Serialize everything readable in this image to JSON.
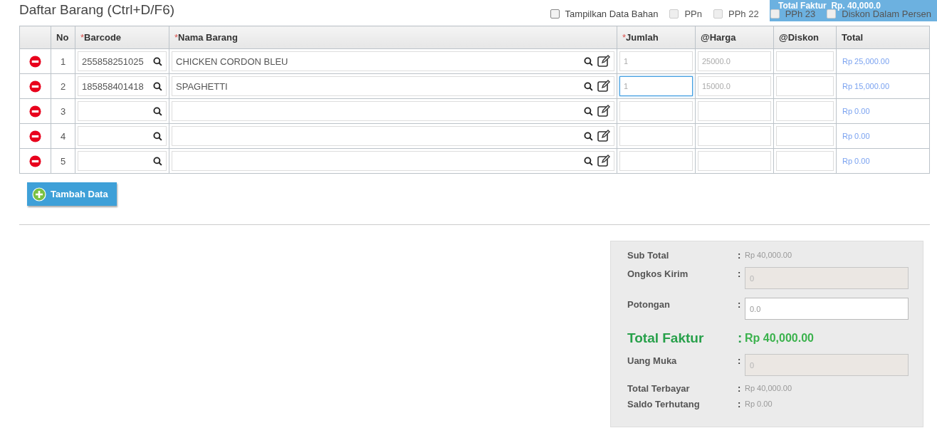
{
  "title": "Daftar Barang (Ctrl+D/F6)",
  "banner": {
    "label": "Total Faktur",
    "value": "Rp. 40,000.0"
  },
  "options": [
    {
      "label": "Tampilkan Data Bahan",
      "checked": false,
      "disabled": false
    },
    {
      "label": "PPn",
      "checked": false,
      "disabled": true
    },
    {
      "label": "PPh 22",
      "checked": false,
      "disabled": true
    },
    {
      "label": "PPh 23",
      "checked": false,
      "disabled": true
    },
    {
      "label": "Diskon Dalam Persen",
      "checked": false,
      "disabled": true
    }
  ],
  "table": {
    "columns": [
      {
        "label": "No",
        "required": false
      },
      {
        "label": "Barcode",
        "required": true
      },
      {
        "label": "Nama Barang",
        "required": true
      },
      {
        "label": "Jumlah",
        "required": true
      },
      {
        "label": "@Harga",
        "required": false
      },
      {
        "label": "@Diskon",
        "required": false
      },
      {
        "label": "Total",
        "required": false
      }
    ],
    "required_mark": "*",
    "rows": [
      {
        "no": "1",
        "barcode": "255858251025",
        "name": "CHICKEN CORDON BLEU",
        "qty": "1",
        "qty_focused": false,
        "price": "25000.0",
        "discount": "",
        "total": "Rp 25,000.00"
      },
      {
        "no": "2",
        "barcode": "185858401418",
        "name": "SPAGHETTI",
        "qty": "1",
        "qty_focused": true,
        "price": "15000.0",
        "discount": "",
        "total": "Rp 15,000.00"
      },
      {
        "no": "3",
        "barcode": "",
        "name": "",
        "qty": "",
        "qty_focused": false,
        "price": "",
        "discount": "",
        "total": "Rp 0.00"
      },
      {
        "no": "4",
        "barcode": "",
        "name": "",
        "qty": "",
        "qty_focused": false,
        "price": "",
        "discount": "",
        "total": "Rp 0.00"
      },
      {
        "no": "5",
        "barcode": "",
        "name": "",
        "qty": "",
        "qty_focused": false,
        "price": "",
        "discount": "",
        "total": "Rp 0.00"
      }
    ]
  },
  "add_button": "Tambah Data",
  "summary": [
    {
      "kind": "text",
      "label": "Sub Total",
      "value": "Rp 40,000.00"
    },
    {
      "kind": "field",
      "label": "Ongkos Kirim",
      "value": "0",
      "disabled": true
    },
    {
      "kind": "field",
      "label": "Potongan",
      "value": "0.0",
      "disabled": false
    },
    {
      "kind": "total",
      "label": "Total Faktur",
      "value": "Rp 40,000.00"
    },
    {
      "kind": "field",
      "label": "Uang Muka",
      "value": "0",
      "disabled": true
    },
    {
      "kind": "text",
      "label": "Total Terbayar",
      "value": "Rp 40,000.00"
    },
    {
      "kind": "text",
      "label": "Saldo Terhutang",
      "value": "Rp 0.00"
    }
  ],
  "separator": ":"
}
